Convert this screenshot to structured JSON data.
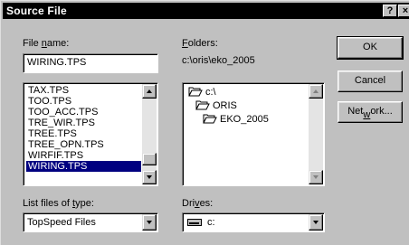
{
  "window": {
    "title": "Source File",
    "help_btn": "?",
    "close_btn": "×"
  },
  "file_name": {
    "label": "File name:",
    "label_key": "n",
    "value": "WIRING.TPS"
  },
  "file_list": {
    "items": [
      "TAX.TPS",
      "TOO.TPS",
      "TOO_ACC.TPS",
      "TRE_WIR.TPS",
      "TREE.TPS",
      "TREE_OPN.TPS",
      "WIRFIF.TPS",
      "WIRING.TPS"
    ],
    "selected": "WIRING.TPS"
  },
  "folders": {
    "label": "Folders:",
    "label_key": "F",
    "current_path": "c:\\oris\\eko_2005",
    "tree": [
      {
        "name": "c:\\",
        "level": 0,
        "icon": "open-folder-icon"
      },
      {
        "name": "ORIS",
        "level": 1,
        "icon": "open-folder-icon"
      },
      {
        "name": "EKO_2005",
        "level": 2,
        "icon": "open-folder-icon"
      }
    ]
  },
  "buttons": {
    "ok": "OK",
    "cancel": "Cancel",
    "network": "Network..."
  },
  "file_type": {
    "label": "List files of type:",
    "label_key": "t",
    "value": "TopSpeed Files"
  },
  "drives": {
    "label": "Drives:",
    "label_key": "v",
    "value": "c:",
    "icon": "drive-icon"
  },
  "colors": {
    "titlebar": "#000000",
    "face": "#c0c0c0",
    "selection": "#000080"
  }
}
